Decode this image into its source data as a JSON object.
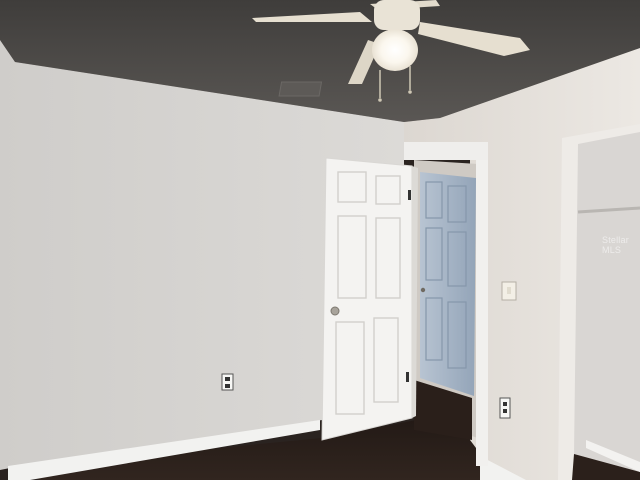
{
  "scene": {
    "description_type": "interior-photo",
    "colors": {
      "ceiling": "#4e4b48",
      "left_wall": "#d6d4d1",
      "right_wall": "#e4e0db",
      "floor": "#2b201b",
      "door": "#f4f3f1",
      "far_door": "#a9b8c8",
      "baseboard": "#f2f2f0",
      "fan_blade": "#e6dfd0"
    },
    "watermark_text": "Stellar MLS"
  }
}
